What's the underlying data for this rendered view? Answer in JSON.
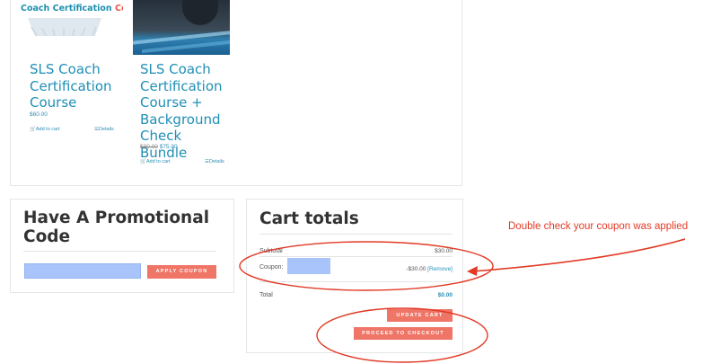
{
  "products": [
    {
      "badge_text": "Coach Certification",
      "badge_accent": "Course",
      "title": "SLS Coach Certification Course",
      "price": "$60.00",
      "old_price": "",
      "add_to_cart": "Add to cart",
      "details": "Details"
    },
    {
      "title": "SLS Coach Certification Course + Background Check Bundle",
      "old_price": "$80.00",
      "price": "$75.00",
      "add_to_cart": "Add to cart",
      "details": "Details"
    }
  ],
  "promo": {
    "title": "Have A Promotional Code",
    "input_value": "",
    "apply_label": "APPLY COUPON"
  },
  "cart": {
    "title": "Cart totals",
    "subtotal_label": "Subtotal",
    "subtotal_value": "$30.00",
    "coupon_label": "Coupon:",
    "coupon_value": "-$30.00",
    "remove_label": "[Remove]",
    "total_label": "Total",
    "total_value": "$0.00",
    "update_label": "UPDATE CART",
    "checkout_label": "PROCEED TO CHECKOUT"
  },
  "annotation": {
    "text": "Double check your coupon was applied",
    "color": "#e23a25"
  },
  "colors": {
    "accent_button": "#ef7567",
    "link_blue": "#1f8fb6",
    "redacted_blue": "#a8c4fb"
  },
  "icons": [
    "cart-icon",
    "list-icon",
    "arrow-annotation",
    "circle-annotation"
  ]
}
